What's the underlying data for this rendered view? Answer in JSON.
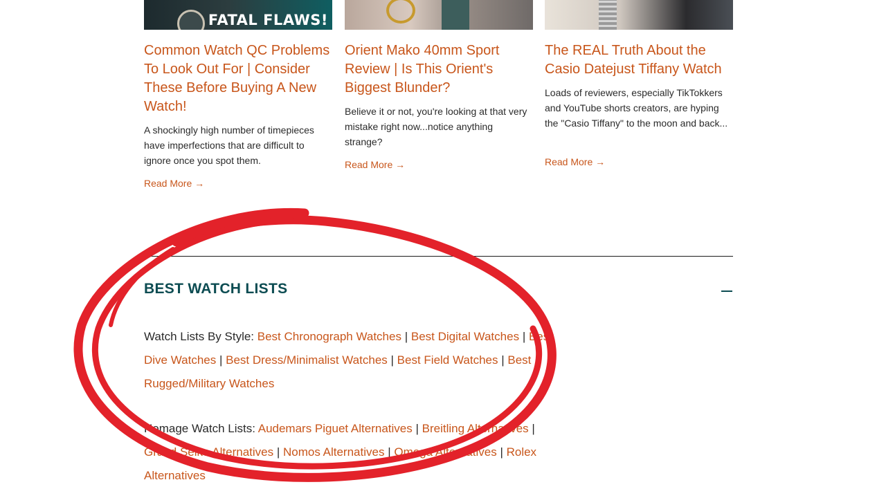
{
  "cards": [
    {
      "thumb_text": "FATAL FLAWS!",
      "title": "Common Watch QC Problems To Look Out For | Consider These Before Buying A New Watch!",
      "excerpt": "A shockingly high number of timepieces have imperfections that are difficult to ignore once you spot them.",
      "read_more": "Read More →"
    },
    {
      "thumb_text": "",
      "title": "Orient Mako 40mm Sport Review | Is This Orient's Biggest Blunder?",
      "excerpt": "Believe it or not, you're looking at that very mistake right now...notice anything strange?",
      "read_more": "Read More →"
    },
    {
      "thumb_text": "",
      "title": "The REAL Truth About the Casio Datejust Tiffany Watch",
      "excerpt": "Loads of reviewers, especially TikTokkers and YouTube shorts creators, are hyping the \"Casio Tiffany\" to the moon and back...",
      "read_more": "Read More →"
    }
  ],
  "section": {
    "title": "BEST WATCH LISTS",
    "collapse_icon": "minus-icon"
  },
  "lists": {
    "style_label": "Watch Lists By Style:",
    "style_links": [
      "Best Chronograph Watches",
      "Best Digital Watches",
      "Best Dive Watches",
      "Best Dress/Minimalist Watches",
      "Best Field Watches",
      "Best Rugged/Military Watches"
    ],
    "homage_label": "Homage Watch Lists:",
    "homage_links": [
      "Audemars Piguet Alternatives",
      "Breitling Alternatives",
      "Grand Seiko Alternatives",
      "Nomos Alternatives",
      "Omega Alternatives",
      "Rolex Alternatives"
    ],
    "separator": "|"
  },
  "colors": {
    "accent": "#c8561b",
    "heading": "#0c4c52",
    "annotation": "#e3222a"
  }
}
